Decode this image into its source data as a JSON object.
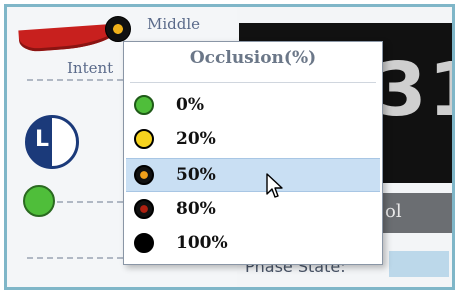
{
  "background": {
    "middle_label": "Middle",
    "intent_label": "Intent",
    "lr_letter": "L",
    "big_digits": "31",
    "gray_box_text": "ol",
    "bottom_text": "Phase State:"
  },
  "menu": {
    "header": "Occlusion(%)",
    "selected_index": 2,
    "items": [
      {
        "label": "0%",
        "color": "#4fbe3a",
        "ring": "#1f5a18",
        "center": null
      },
      {
        "label": "20%",
        "color": "#f5d21e",
        "ring": "#000000",
        "center": null
      },
      {
        "label": "50%",
        "color": "#111111",
        "ring": "#000000",
        "center": "#f0a01a"
      },
      {
        "label": "80%",
        "color": "#111111",
        "ring": "#000000",
        "center": "#b02010"
      },
      {
        "label": "100%",
        "color": "#000000",
        "ring": "#000000",
        "center": null
      }
    ]
  },
  "icons": {
    "cursor": "mouse-pointer-icon"
  }
}
